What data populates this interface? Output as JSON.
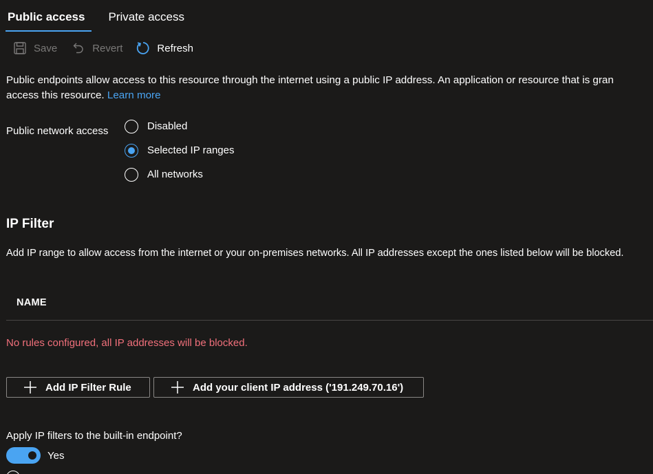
{
  "tabs": [
    {
      "label": "Public access",
      "active": true
    },
    {
      "label": "Private access",
      "active": false
    }
  ],
  "toolbar": {
    "save_label": "Save",
    "revert_label": "Revert",
    "refresh_label": "Refresh",
    "icons": {
      "save": "save-icon",
      "revert": "undo-icon",
      "refresh": "refresh-icon"
    }
  },
  "description": {
    "line1": "Public endpoints allow access to this resource through the internet using a public IP address. An application or resource that is gran",
    "line2": "access this resource.",
    "learn_more": "Learn more"
  },
  "public_network_access": {
    "label": "Public network access",
    "options": [
      {
        "label": "Disabled",
        "checked": false
      },
      {
        "label": "Selected IP ranges",
        "checked": true
      },
      {
        "label": "All networks",
        "checked": false
      }
    ]
  },
  "ip_filter": {
    "title": "IP Filter",
    "description": "Add IP range to allow access from the internet or your on-premises networks. All IP addresses except the ones listed below will be blocked.",
    "column_name": "NAME",
    "empty_message": "No rules configured, all IP addresses will be blocked.",
    "add_rule_label": "Add IP Filter Rule",
    "add_client_label": "Add your client IP address ('191.249.70.16')"
  },
  "apply_builtin": {
    "label": "Apply IP filters to the built-in endpoint?",
    "toggle_label": "Yes",
    "enabled": true
  },
  "colors": {
    "background": "#1b1a19",
    "accent": "#4aa4f2",
    "error": "#f1707b",
    "disabled": "#7a7978",
    "border": "#8a8886"
  }
}
